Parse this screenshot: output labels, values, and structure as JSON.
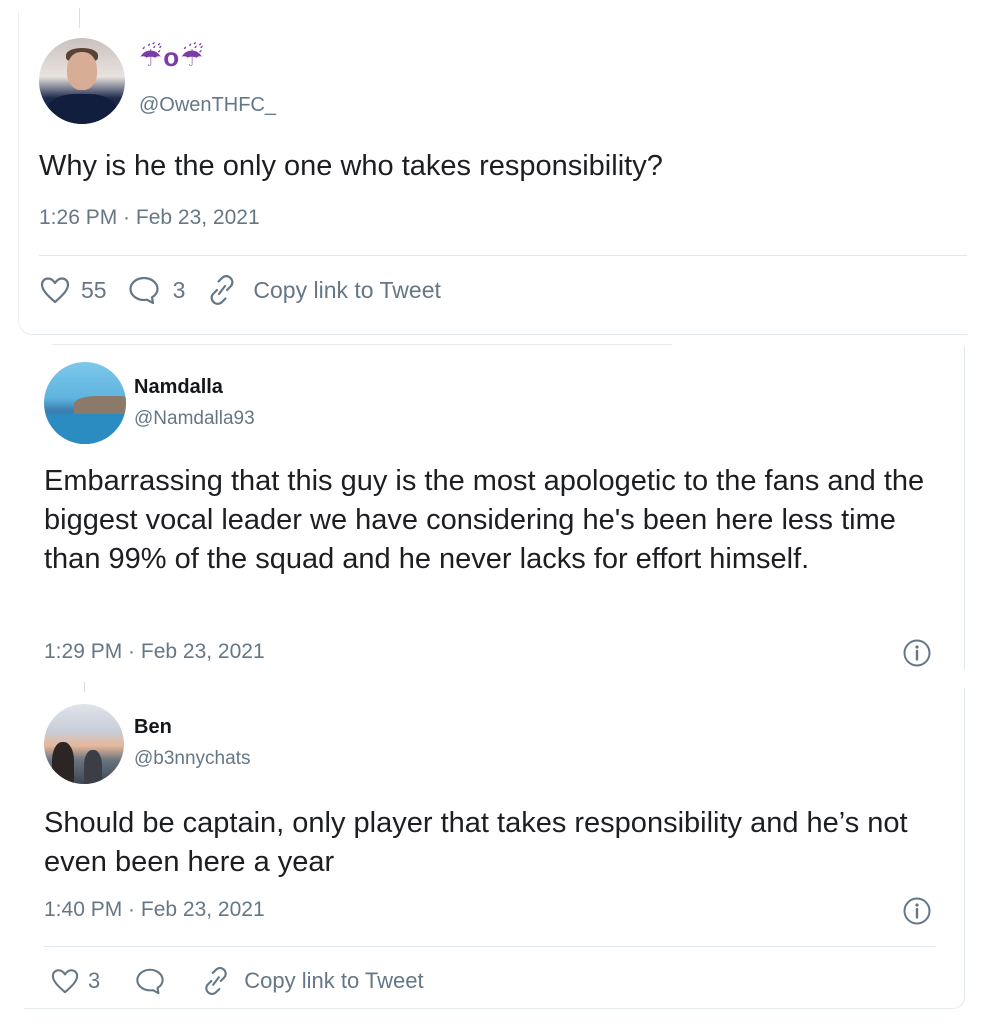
{
  "tweet": {
    "display_name": "☔o☔",
    "handle": "@OwenTHFC_",
    "text": "Why is he the only one who takes responsibility?",
    "timestamp": "1:26 PM · Feb 23, 2021",
    "likes": "55",
    "replies": "3",
    "copy_link_label": "Copy link to Tweet"
  },
  "replies": [
    {
      "display_name": "Namdalla",
      "handle": "@Namdalla93",
      "text": "Embarrassing that this guy is the most apologetic to the fans and the biggest vocal leader we have considering he's been here less time than 99% of the squad and he never lacks for effort himself.",
      "timestamp": "1:29 PM · Feb 23, 2021"
    },
    {
      "display_name": "Ben",
      "handle": "@b3nnychats",
      "text": "Should be captain, only player that takes responsibility and he’s not even been here a year",
      "timestamp": "1:40 PM · Feb 23, 2021",
      "likes": "3",
      "copy_link_label": "Copy link to Tweet"
    }
  ],
  "colors": {
    "text_primary": "#1c1e21",
    "text_secondary": "#657786",
    "divider": "#e1e8ed",
    "display_name_accent": "#7b3ca7"
  },
  "icons": {
    "like": "heart-icon",
    "reply": "speech-bubble-icon",
    "copy_link": "link-icon",
    "info": "info-icon"
  }
}
